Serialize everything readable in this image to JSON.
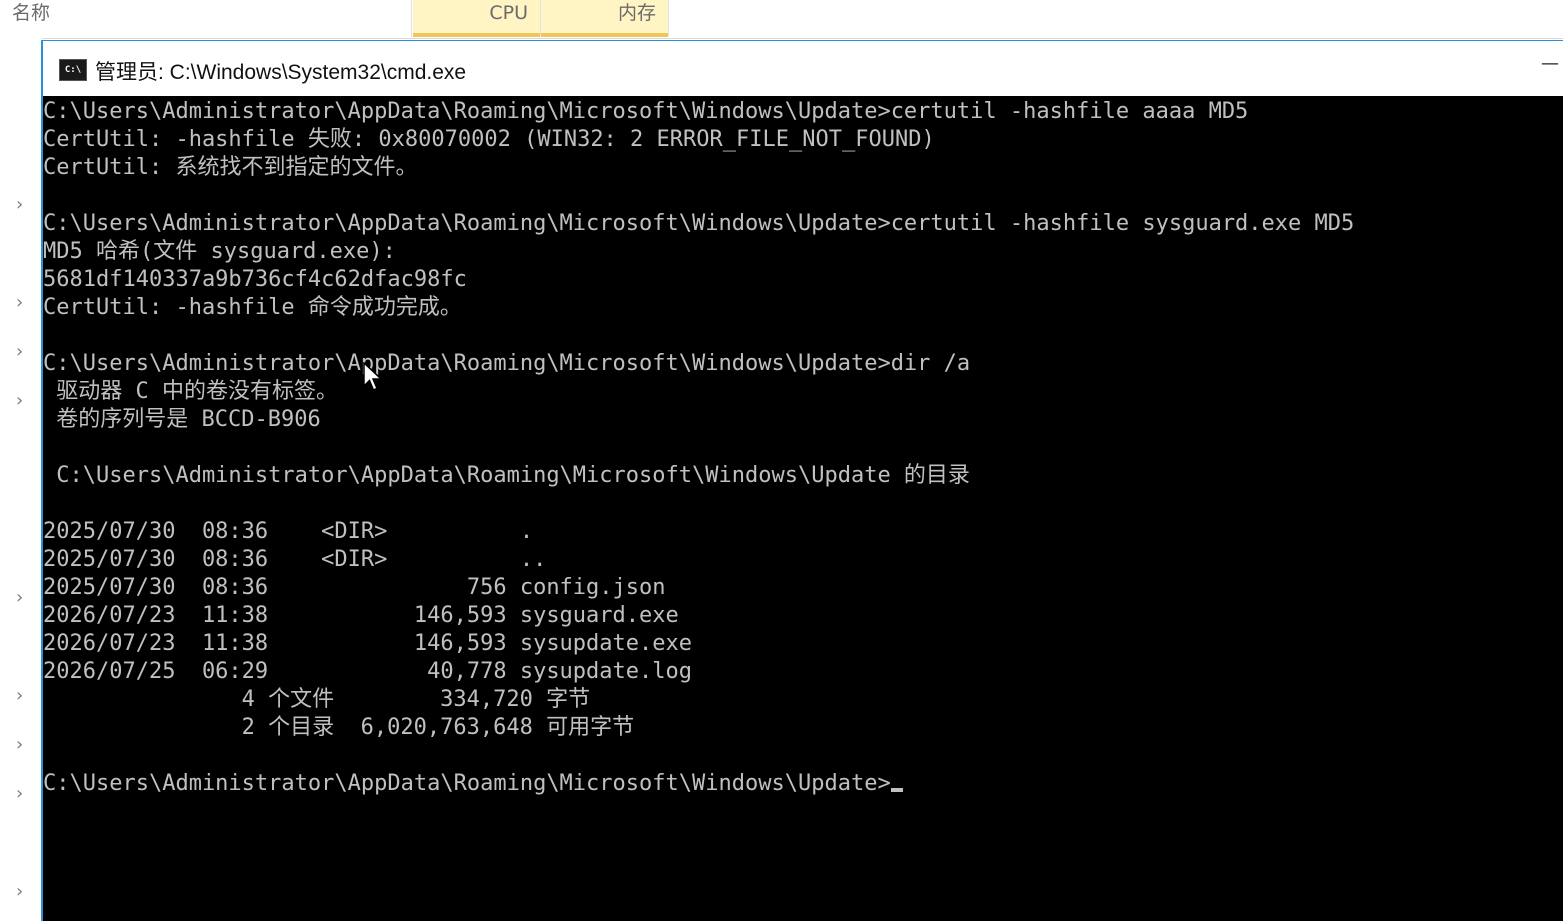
{
  "task_manager": {
    "columns": {
      "name": "名称",
      "cpu": "CPU",
      "memory": "内存"
    }
  },
  "cmd": {
    "title": "管理员: C:\\Windows\\System32\\cmd.exe",
    "icon_text": "C:\\",
    "lines": [
      "C:\\Users\\Administrator\\AppData\\Roaming\\Microsoft\\Windows\\Update>certutil -hashfile aaaa MD5",
      "CertUtil: -hashfile 失败: 0x80070002 (WIN32: 2 ERROR_FILE_NOT_FOUND)",
      "CertUtil: 系统找不到指定的文件。",
      "",
      "C:\\Users\\Administrator\\AppData\\Roaming\\Microsoft\\Windows\\Update>certutil -hashfile sysguard.exe MD5",
      "MD5 哈希(文件 sysguard.exe):",
      "5681df140337a9b736cf4c62dfac98fc",
      "CertUtil: -hashfile 命令成功完成。",
      "",
      "C:\\Users\\Administrator\\AppData\\Roaming\\Microsoft\\Windows\\Update>dir /a",
      " 驱动器 C 中的卷没有标签。",
      " 卷的序列号是 BCCD-B906",
      "",
      " C:\\Users\\Administrator\\AppData\\Roaming\\Microsoft\\Windows\\Update 的目录",
      "",
      "2025/07/30  08:36    <DIR>          .",
      "2025/07/30  08:36    <DIR>          ..",
      "2025/07/30  08:36               756 config.json",
      "2026/07/23  11:38           146,593 sysguard.exe",
      "2026/07/23  11:38           146,593 sysupdate.exe",
      "2026/07/25  06:29            40,778 sysupdate.log",
      "               4 个文件        334,720 字节",
      "               2 个目录  6,020,763,648 可用字节",
      "",
      "C:\\Users\\Administrator\\AppData\\Roaming\\Microsoft\\Windows\\Update>"
    ]
  },
  "colors": {
    "console_background": "#000000",
    "console_text": "#c0c0c0",
    "window_accent": "#2d8fd6",
    "column_highlight": "#fff4c4"
  }
}
